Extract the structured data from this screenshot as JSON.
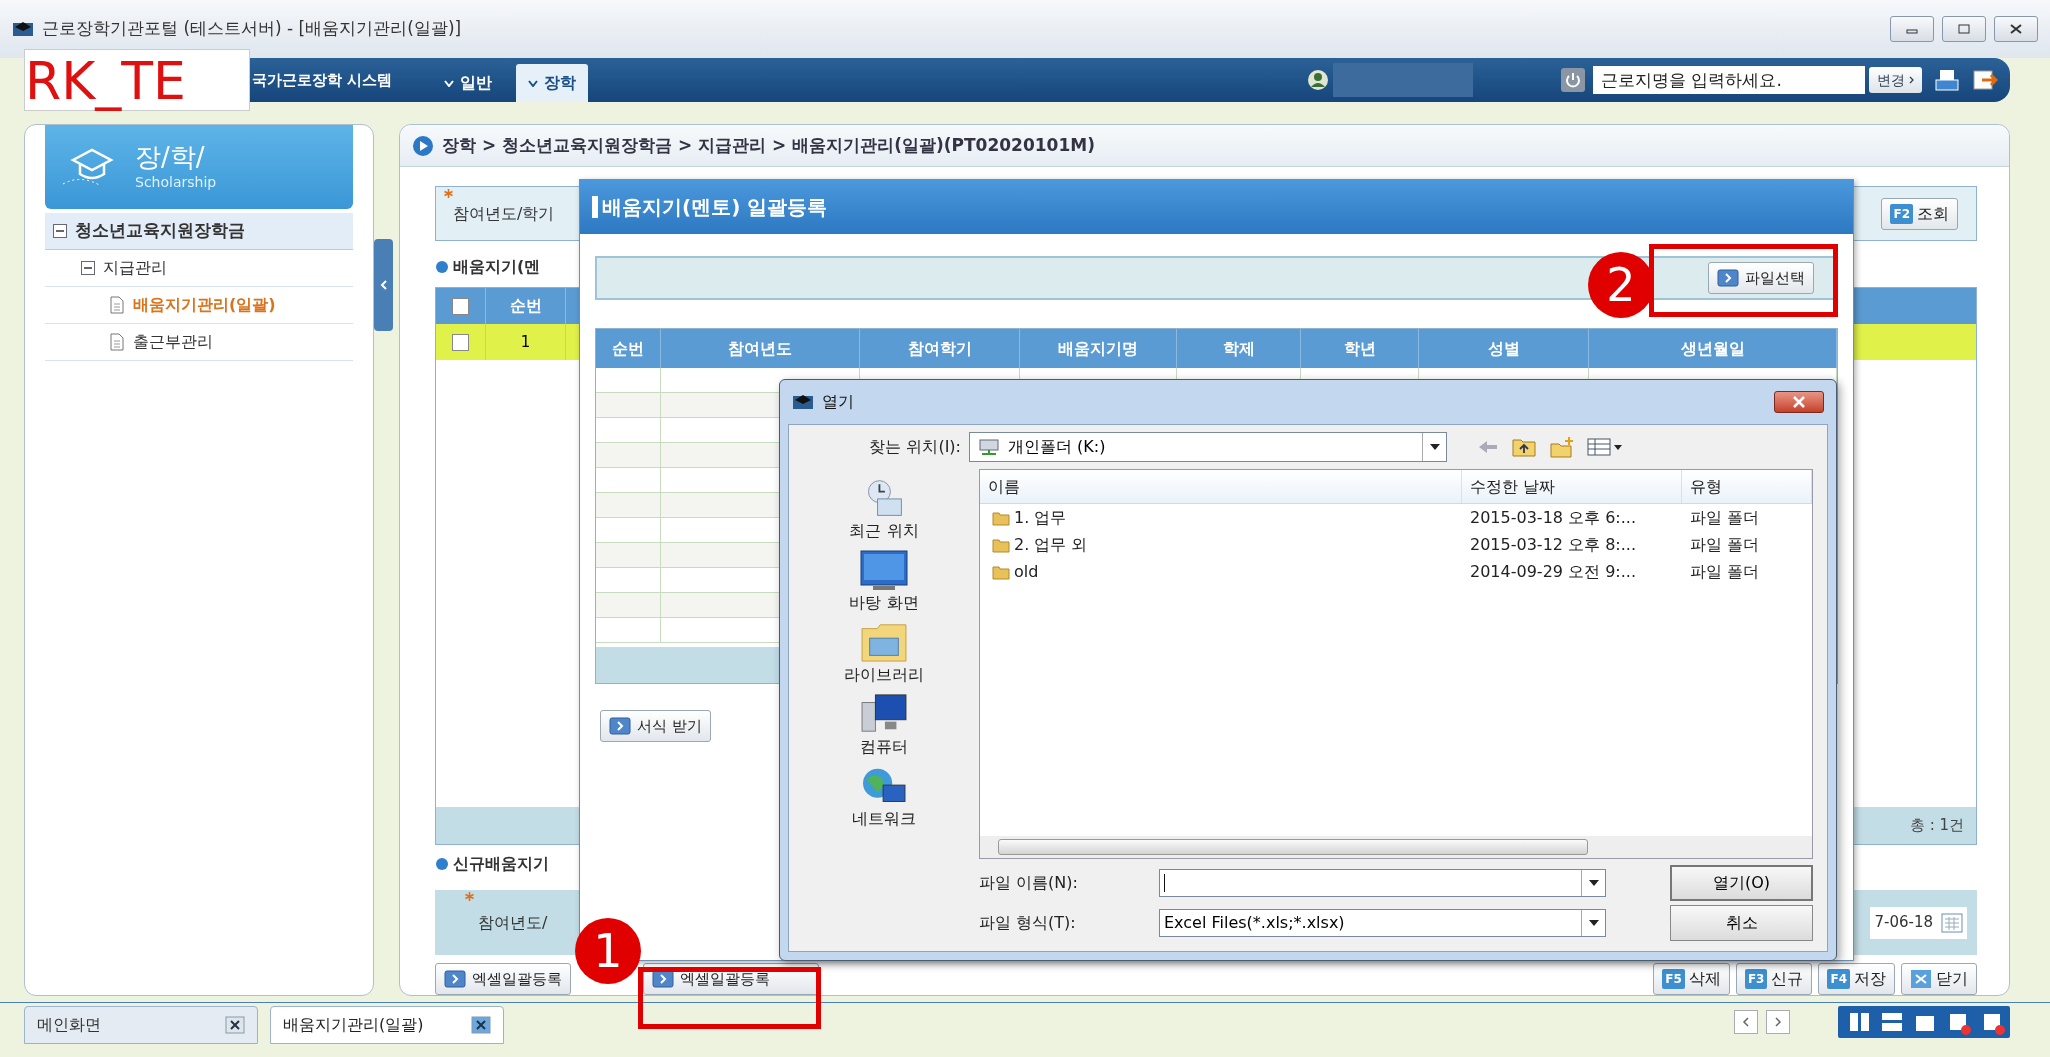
{
  "window": {
    "title": "근로장학기관포털 (테스트서버) - [배움지기관리(일괄)]"
  },
  "nav": {
    "label": "RK_TE",
    "system": "국가근로장학 시스템",
    "menus": [
      {
        "label": "일반",
        "selected": false
      },
      {
        "label": "장학",
        "selected": true
      }
    ],
    "search": {
      "placeholder": "근로지명을 입력하세요."
    },
    "change_button": "변경"
  },
  "sidebar": {
    "title": "장/학/",
    "subtitle": "Scholarship",
    "tree": [
      {
        "label": "청소년교육지원장학금",
        "expanded": true,
        "children": [
          {
            "label": "지급관리",
            "expanded": true,
            "children": [
              {
                "label": "배움지기관리(일괄)",
                "selected": true
              },
              {
                "label": "출근부관리",
                "selected": false
              }
            ]
          }
        ]
      }
    ]
  },
  "breadcrumb": "장학 > 청소년교육지원장학금 > 지급관리 > 배움지기관리(일괄)(PT02020101M)",
  "search_panel": {
    "label": "참여년도/학기",
    "required": true,
    "button": {
      "key": "F2",
      "label": "조회"
    }
  },
  "list_section": {
    "heading": "배움지기(멘",
    "header_checked": false,
    "columns": [
      "순번"
    ],
    "rows": [
      {
        "cells": [
          "1"
        ],
        "checked": false,
        "selected": true
      }
    ],
    "total": "총 : 1건"
  },
  "new_section": {
    "heading": "신규배움지기",
    "field_label": "참여년도/",
    "required": true,
    "date": "7-06-18"
  },
  "footer_buttons": [
    {
      "label": "엑셀일괄등록"
    },
    {
      "label": "엑셀일괄등록"
    }
  ],
  "actions": [
    {
      "kind": "key",
      "key": "F5",
      "label": "삭제"
    },
    {
      "kind": "key",
      "key": "F3",
      "label": "신규"
    },
    {
      "kind": "key",
      "key": "F4",
      "label": "저장"
    },
    {
      "kind": "close",
      "label": "닫기"
    }
  ],
  "tabs": [
    {
      "label": "메인화면",
      "selected": false
    },
    {
      "label": "배움지기관리(일괄)",
      "selected": true
    }
  ],
  "bulk_dialog": {
    "title": "배움지기(멘토) 일괄등록",
    "file_button": "파일선택",
    "columns": [
      "순번",
      "참여년도",
      "참여학기",
      "배움지기명",
      "학제",
      "학년",
      "성별",
      "생년월일"
    ],
    "template_button": "서식 받기"
  },
  "open_dialog": {
    "title": "열기",
    "location_label": "찾는 위치(I):",
    "location": "개인폴더 (K:)",
    "places": [
      {
        "kind": "recent",
        "label": "최근 위치"
      },
      {
        "kind": "desktop",
        "label": "바탕 화면"
      },
      {
        "kind": "library",
        "label": "라이브러리"
      },
      {
        "kind": "computer",
        "label": "컴퓨터"
      },
      {
        "kind": "network",
        "label": "네트워크"
      }
    ],
    "columns": [
      "이름",
      "수정한 날짜",
      "유형"
    ],
    "files": [
      {
        "name": "1. 업무",
        "date": "2015-03-18 오후 6:...",
        "type": "파일 폴더"
      },
      {
        "name": "2. 업무 외",
        "date": "2015-03-12 오후 8:...",
        "type": "파일 폴더"
      },
      {
        "name": "old",
        "date": "2014-09-29 오전 9:...",
        "type": "파일 폴더"
      }
    ],
    "filename_label": "파일 이름(N):",
    "filetype_label": "파일 형식(T):",
    "filetype": "Excel Files(*.xls;*.xlsx)",
    "open_button": "열기(O)",
    "cancel_button": "취소"
  },
  "annotations": [
    {
      "number": "1"
    },
    {
      "number": "2"
    }
  ]
}
